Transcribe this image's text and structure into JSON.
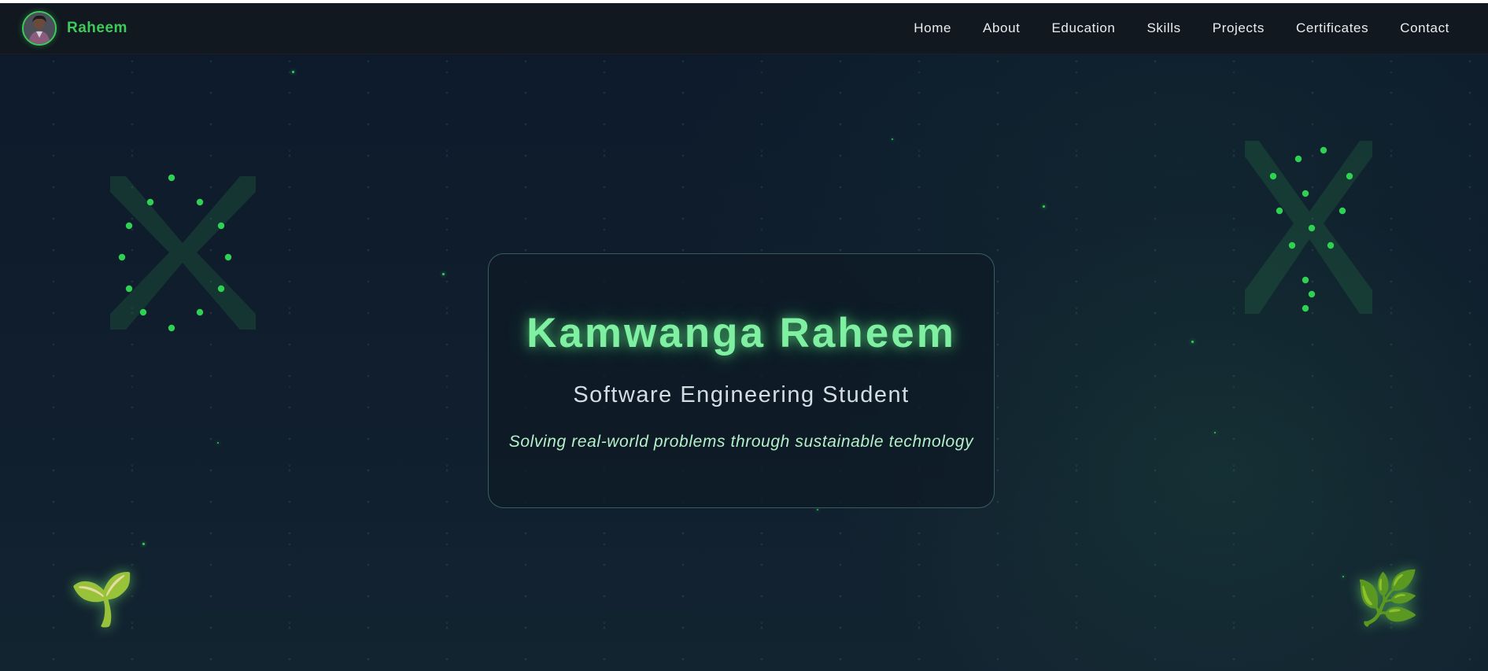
{
  "navbar": {
    "brand_name": "Raheem",
    "avatar_icon": "profile-photo",
    "links": [
      {
        "label": "Home"
      },
      {
        "label": "About"
      },
      {
        "label": "Education"
      },
      {
        "label": "Skills"
      },
      {
        "label": "Projects"
      },
      {
        "label": "Certificates"
      },
      {
        "label": "Contact"
      }
    ]
  },
  "hero": {
    "name": "Kamwanga Raheem",
    "subtitle": "Software Engineering Student",
    "tagline": "Solving real-world problems through sustainable technology"
  },
  "decorations": {
    "left_plant_icon": "seedling-icon",
    "left_plant_glyph": "🌱",
    "right_plant_icon": "herb-icon",
    "right_plant_glyph": "🌿"
  },
  "colors": {
    "accent": "#3dcb5a",
    "name_glow": "#7ff0a2",
    "background": "#0d1a2b",
    "tagline": "#b4f0c8"
  }
}
